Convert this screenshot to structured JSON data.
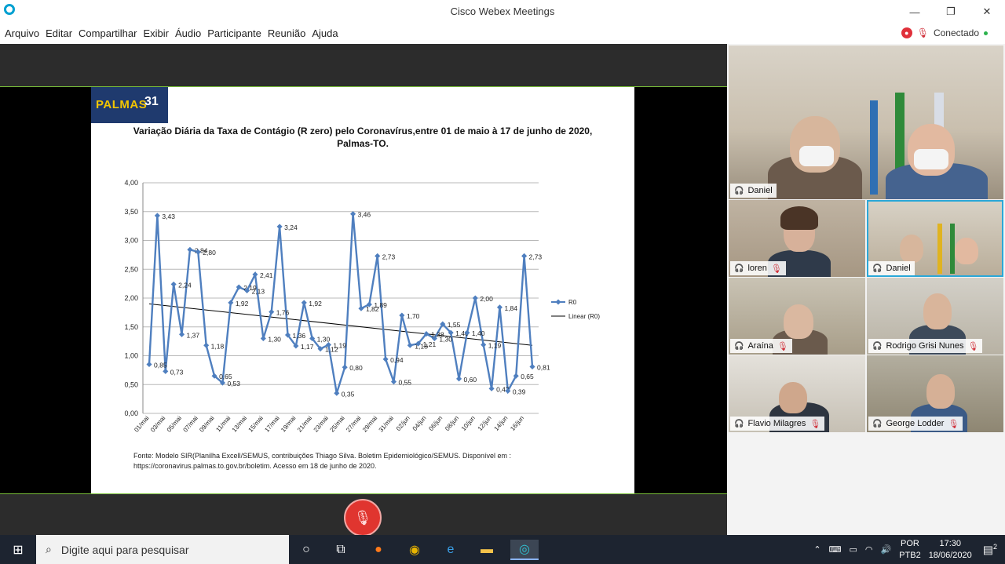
{
  "window": {
    "title": "Cisco Webex Meetings",
    "status": "Conectado"
  },
  "menu": [
    "Arquivo",
    "Editar",
    "Compartilhar",
    "Exibir",
    "Áudio",
    "Participante",
    "Reunião",
    "Ajuda"
  ],
  "slide": {
    "logo_text": "PALMAS",
    "logo_number": "31",
    "title_line1": "Variação Diária da Taxa de Contágio (R zero) pelo Coronavírus,entre 01 de maio à 17 de junho de 2020,",
    "title_line2": "Palmas-TO.",
    "source_line1": "Fonte: Modelo SIR(Planilha Excell/SEMUS, contribuições Thiago Silva. Boletim Epidemiológico/SEMUS. Disponível em :",
    "source_line2": "https://coronavirus.palmas.to.gov.br/boletim. Acesso em 18 de junho de 2020."
  },
  "chart_data": {
    "type": "line",
    "title": "Variação Diária da Taxa de Contágio (R zero) pelo Coronavírus,entre 01 de maio à 17 de junho de 2020, Palmas-TO.",
    "ylim": [
      0,
      4
    ],
    "yticks": [
      "0,00",
      "0,50",
      "1,00",
      "1,50",
      "2,00",
      "2,50",
      "3,00",
      "3,50",
      "4,00"
    ],
    "x_tick_labels": [
      "01/mai",
      "03/mai",
      "05/mai",
      "07/mai",
      "09/mai",
      "11/mai",
      "13/mai",
      "15/mai",
      "17/mai",
      "19/mai",
      "21/mai",
      "23/mai",
      "25/mai",
      "27/mai",
      "29/mai",
      "31/mai",
      "02/jun",
      "04/jun",
      "06/jun",
      "08/jun",
      "10/jun",
      "12/jun",
      "14/jun",
      "16/jun"
    ],
    "grid": true,
    "legend_position": "right",
    "series": [
      {
        "name": "R0",
        "color": "#4f7fbf",
        "values": [
          0.85,
          3.43,
          0.73,
          2.24,
          1.37,
          2.84,
          2.8,
          1.18,
          0.65,
          0.53,
          1.92,
          2.19,
          2.13,
          2.41,
          1.3,
          1.76,
          3.24,
          1.36,
          1.17,
          1.92,
          1.3,
          1.12,
          1.19,
          0.35,
          0.8,
          3.46,
          1.82,
          1.89,
          2.73,
          0.94,
          0.55,
          1.7,
          1.18,
          1.21,
          1.38,
          1.3,
          1.55,
          1.4,
          0.6,
          1.4,
          2.0,
          1.19,
          0.43,
          1.84,
          0.39,
          0.65,
          2.73,
          0.81
        ],
        "labels": [
          "0,85",
          "3,43",
          "0,73",
          "2,24",
          "1,37",
          "2,84",
          "2,80",
          "1,18",
          "0,65",
          "0,53",
          "1,92",
          "2,19",
          "2,13",
          "2,41",
          "1,30",
          "1,76",
          "3,24",
          "1,36",
          "1,17",
          "1,92",
          "1,30",
          "1,12",
          "1,19",
          "0,35",
          "0,80",
          "3,46",
          "1,82",
          "1,89",
          "2,73",
          "0,94",
          "0,55",
          "1,70",
          "1,18",
          "1,21",
          "1,38",
          "1,30",
          "1,55",
          "1,40",
          "0,60",
          "1,40",
          "2,00",
          "1,19",
          "0,43",
          "1,84",
          "0,39",
          "0,65",
          "2,73",
          "0,81"
        ]
      },
      {
        "name": "Linear (R0)",
        "color": "#000000",
        "trend": [
          1.9,
          1.18
        ]
      }
    ]
  },
  "participants": [
    {
      "name": "Daniel",
      "muted": false
    },
    {
      "name": "loren",
      "muted": true
    },
    {
      "name": "Daniel",
      "muted": false
    },
    {
      "name": "Araína",
      "muted": true
    },
    {
      "name": "Rodrigo Grisi Nunes",
      "muted": true
    },
    {
      "name": "Flavio Milagres",
      "muted": true
    },
    {
      "name": "George Lodder",
      "muted": true
    }
  ],
  "taskbar": {
    "search_placeholder": "Digite aqui para pesquisar",
    "lang1": "POR",
    "lang2": "PTB2",
    "time": "17:30",
    "date": "18/06/2020",
    "notifications": "2"
  }
}
